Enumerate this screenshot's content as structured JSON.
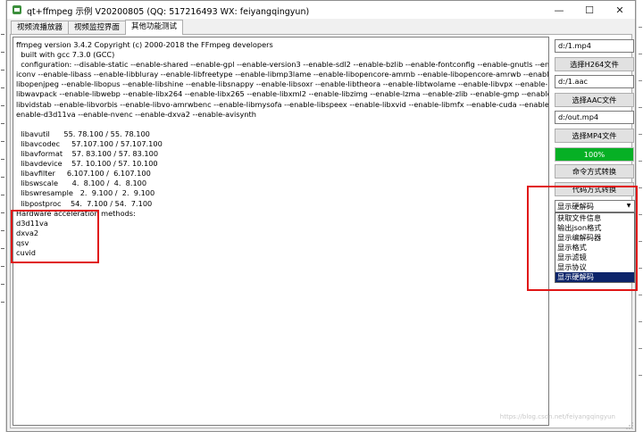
{
  "window": {
    "title": "qt+ffmpeg 示例 V20200805 (QQ: 517216493 WX: feiyangqingyun)",
    "controls": {
      "minimize": "—",
      "maximize": "☐",
      "close": "✕"
    }
  },
  "tabs": [
    {
      "label": "视频流播放器",
      "active": false
    },
    {
      "label": "视频监控界面",
      "active": false
    },
    {
      "label": "其他功能测试",
      "active": true
    }
  ],
  "log_lines": [
    "ffmpeg version 3.4.2 Copyright (c) 2000-2018 the FFmpeg developers",
    "  built with gcc 7.3.0 (GCC)",
    "  configuration: --disable-static --enable-shared --enable-gpl --enable-version3 --enable-sdl2 --enable-bzlib --enable-fontconfig --enable-gnutls --enable-",
    "iconv --enable-libass --enable-libbluray --enable-libfreetype --enable-libmp3lame --enable-libopencore-amrnb --enable-libopencore-amrwb --enable-",
    "libopenjpeg --enable-libopus --enable-libshine --enable-libsnappy --enable-libsoxr --enable-libtheora --enable-libtwolame --enable-libvpx --enable-",
    "libwavpack --enable-libwebp --enable-libx264 --enable-libx265 --enable-libxml2 --enable-libzimg --enable-lzma --enable-zlib --enable-gmp --enable-",
    "libvidstab --enable-libvorbis --enable-libvo-amrwbenc --enable-libmysofa --enable-libspeex --enable-libxvid --enable-libmfx --enable-cuda --enable-cuvid --",
    "enable-d3d11va --enable-nvenc --enable-dxva2 --enable-avisynth",
    "",
    "  libavutil      55. 78.100 / 55. 78.100",
    "  libavcodec     57.107.100 / 57.107.100",
    "  libavformat    57. 83.100 / 57. 83.100",
    "  libavdevice    57. 10.100 / 57. 10.100",
    "  libavfilter     6.107.100 /  6.107.100",
    "  libswscale      4.  8.100 /  4.  8.100",
    "  libswresample   2.  9.100 /  2.  9.100",
    "  libpostproc    54.  7.100 / 54.  7.100",
    "Hardware acceleration methods:",
    "d3d11va",
    "dxva2",
    "qsv",
    "cuvid"
  ],
  "controls": {
    "h264_path": "d:/1.mp4",
    "h264_button": "选择H264文件",
    "aac_path": "d:/1.aac",
    "aac_button": "选择AAC文件",
    "mp4_path": "d:/out.mp4",
    "mp4_button": "选择MP4文件",
    "progress_percent": 100,
    "progress_label": "100%",
    "cmd_convert_button": "命令方式转换",
    "code_convert_button": "代码方式转换",
    "combo_value": "显示硬解码",
    "combo_options": [
      "获取文件信息",
      "输出json格式",
      "显示编解码器",
      "显示格式",
      "显示滤镜",
      "显示协议",
      "显示硬解码"
    ],
    "combo_selected_index": 6
  },
  "watermark": "https://blog.csdn.net/feiyangqingyun",
  "colors": {
    "progress_fill": "#06b025",
    "selection": "#0c246a",
    "annotation_red": "#e01616"
  }
}
